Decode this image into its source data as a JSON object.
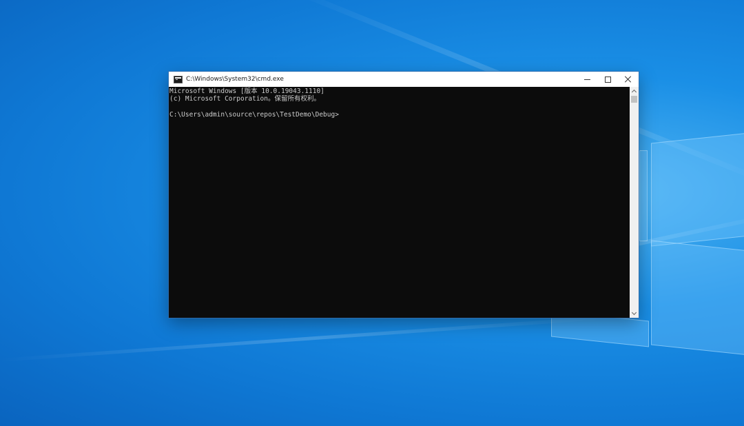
{
  "window": {
    "title": "C:\\Windows\\System32\\cmd.exe",
    "app_icon": "cmd-icon"
  },
  "console": {
    "lines": [
      "Microsoft Windows [版本 10.0.19043.1110]",
      "(c) Microsoft Corporation。保留所有权利。",
      "",
      "C:\\Users\\admin\\source\\repos\\TestDemo\\Debug>"
    ],
    "background_color": "#0c0c0c",
    "text_color": "#cccccc"
  },
  "caption_buttons": [
    "minimize-icon",
    "maximize-icon",
    "close-icon"
  ]
}
